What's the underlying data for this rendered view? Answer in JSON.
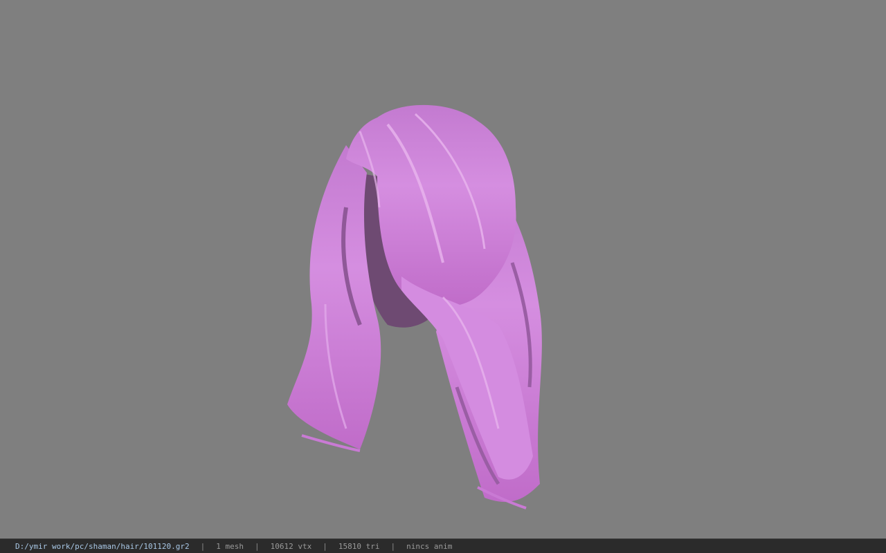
{
  "viewer": {
    "background_color": "#7f7f7f",
    "model_color": "#c877d2",
    "model_icon": "hair-mesh-model"
  },
  "statusbar": {
    "file_path": "D:/ymir work/pc/shaman/hair/101120.gr2",
    "separator": "|",
    "mesh_count": "1 mesh",
    "vertex_count": "10612 vtx",
    "triangle_count": "15810 tri",
    "anim_status": "nincs anim"
  }
}
